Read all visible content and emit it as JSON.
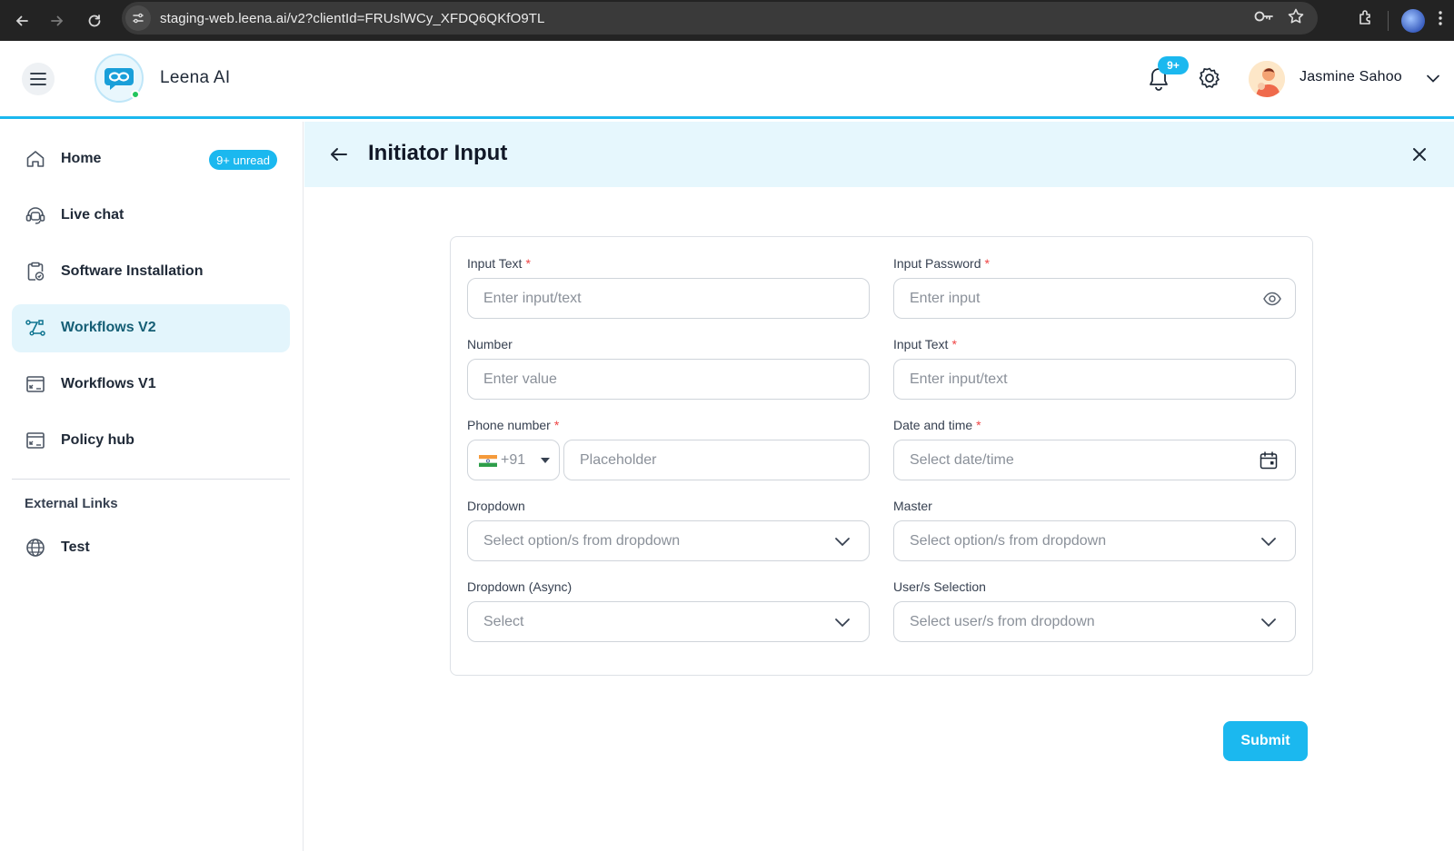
{
  "browser": {
    "url": "staging-web.leena.ai/v2?clientId=FRUslWCy_XFDQ6QKfO9TL",
    "icons": [
      "back-icon",
      "forward-icon",
      "reload-icon",
      "site-info-icon",
      "password-key-icon",
      "bookmark-star-icon",
      "extensions-icon",
      "profile-icon",
      "kebab-menu-icon"
    ]
  },
  "header": {
    "brand": "Leena AI",
    "notification_count": "9+",
    "user_name": "Jasmine Sahoo",
    "accent_color": "#1bb8ef"
  },
  "sidebar": {
    "items": [
      {
        "label": "Home",
        "badge": "9+ unread",
        "icon": "home-icon"
      },
      {
        "label": "Live chat",
        "icon": "headset-icon"
      },
      {
        "label": "Software Installation",
        "icon": "clipboard-check-icon"
      },
      {
        "label": "Workflows V2",
        "icon": "workflow-icon",
        "active": true
      },
      {
        "label": "Workflows V1",
        "icon": "window-icon"
      },
      {
        "label": "Policy hub",
        "icon": "window-icon"
      }
    ],
    "section_title": "External Links",
    "links": [
      {
        "label": "Test",
        "icon": "globe-icon"
      }
    ]
  },
  "page": {
    "title": "Initiator Input",
    "submit_label": "Submit"
  },
  "form": {
    "input_text": {
      "label": "Input Text",
      "required": "*",
      "placeholder": "Enter input/text"
    },
    "input_password": {
      "label": "Input Password",
      "required": "*",
      "placeholder": "Enter input"
    },
    "number": {
      "label": "Number",
      "placeholder": "Enter value"
    },
    "input_text_2": {
      "label": "Input Text",
      "required": "*",
      "placeholder": "Enter input/text"
    },
    "phone": {
      "label": "Phone number",
      "required": "*",
      "country_code": "+91",
      "placeholder": "Placeholder"
    },
    "datetime": {
      "label": "Date and time",
      "required": "*",
      "placeholder": "Select date/time"
    },
    "dropdown": {
      "label": "Dropdown",
      "placeholder": "Select option/s from dropdown"
    },
    "master": {
      "label": "Master",
      "placeholder": "Select option/s from dropdown"
    },
    "dropdown_async": {
      "label": "Dropdown (Async)",
      "placeholder": "Select"
    },
    "users": {
      "label": "User/s Selection",
      "placeholder": "Select user/s from dropdown"
    }
  }
}
